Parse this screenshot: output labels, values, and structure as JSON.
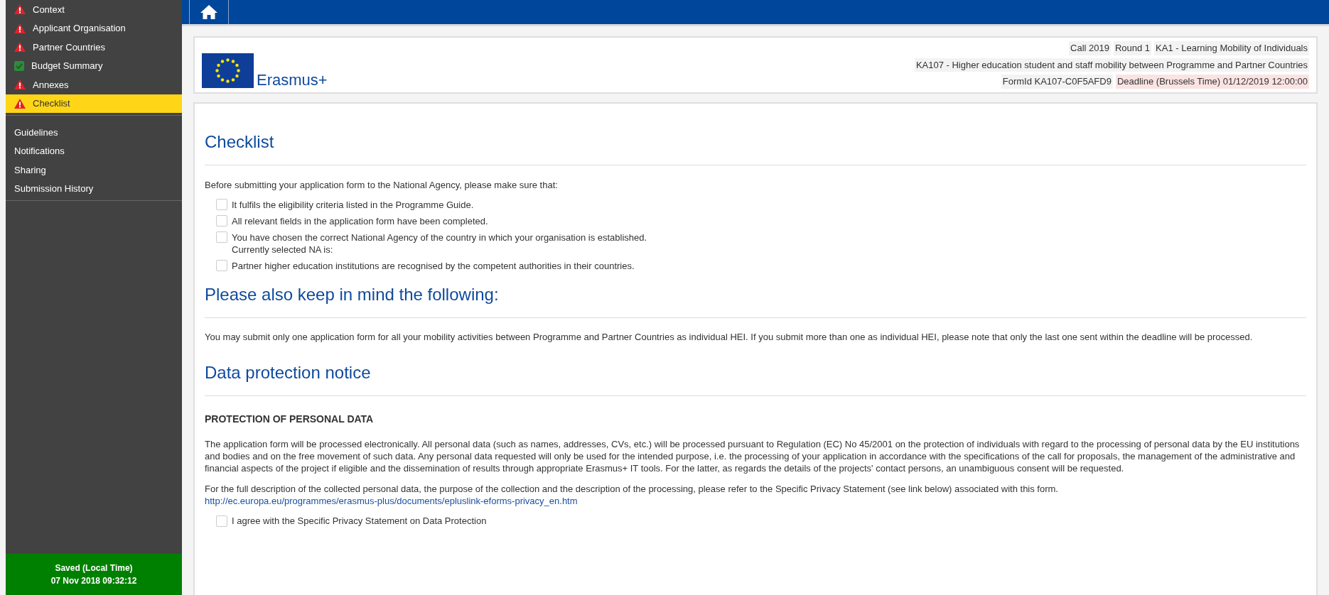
{
  "sidebar": {
    "sections": [
      {
        "kind": "status",
        "items": [
          {
            "label": "Context",
            "kind": "warning",
            "selected": false
          },
          {
            "label": "Applicant Organisation",
            "kind": "warning",
            "selected": false
          },
          {
            "label": "Partner Countries",
            "kind": "warning",
            "selected": false
          },
          {
            "label": "Budget Summary",
            "kind": "complete",
            "selected": false
          },
          {
            "label": "Annexes",
            "kind": "warning",
            "selected": false
          },
          {
            "label": "Checklist",
            "kind": "warning",
            "selected": true
          }
        ]
      },
      {
        "kind": "links",
        "items": [
          {
            "label": "Guidelines"
          },
          {
            "label": "Notifications"
          },
          {
            "label": "Sharing"
          },
          {
            "label": "Submission History"
          }
        ]
      }
    ],
    "saved": {
      "label": "Saved (Local Time)",
      "time": "07 Nov 2018 09:32:12"
    }
  },
  "header": {
    "logo_text": "Erasmus+",
    "info_rows": [
      [
        {
          "text": "Call 2019",
          "kind": "plain"
        },
        {
          "text": "Round 1",
          "kind": "plain"
        },
        {
          "text": "KA1 - Learning Mobility of Individuals",
          "kind": "plain"
        }
      ],
      [
        {
          "text": "KA107 - Higher education student and staff mobility between Programme and Partner Countries",
          "kind": "plain"
        }
      ],
      [
        {
          "text": "FormId KA107-C0F5AFD9",
          "kind": "plain"
        },
        {
          "text": "Deadline (Brussels Time) 01/12/2019 12:00:00",
          "kind": "deadline"
        }
      ]
    ]
  },
  "checklist": {
    "title": "Checklist",
    "intro": "Before submitting your application form to the National Agency, please make sure that:",
    "items": [
      {
        "text": "It fulfils the eligibility criteria listed in the Programme Guide.",
        "checked": false
      },
      {
        "text": "All relevant fields in the application form have been completed.",
        "checked": false
      },
      {
        "text": "You have chosen the correct National Agency of the country in which your organisation is established.",
        "note": "Currently selected NA is:",
        "checked": false
      },
      {
        "text": "Partner higher education institutions are recognised by the competent authorities in their countries.",
        "checked": false
      }
    ]
  },
  "reminder": {
    "title": "Please also keep in mind the following:",
    "text": "You may submit only one application form for all your mobility activities between Programme and Partner Countries as individual HEI. If you submit more than one as individual HEI, please note that only the last one sent within the deadline will be processed."
  },
  "data_protection": {
    "title": "Data protection notice",
    "subtitle": "PROTECTION OF PERSONAL DATA",
    "paragraph": "The application form will be processed electronically. All personal data (such as names, addresses, CVs, etc.) will be processed pursuant to Regulation (EC) No 45/2001 on the protection of individuals with regard to the processing of personal data by the EU institutions and bodies and on the free movement of such data. Any personal data requested will only be used for the intended purpose, i.e. the processing of your application in accordance with the specifications of the call for proposals, the management of the administrative and financial aspects of the project if eligible and the dissemination of results through appropriate Erasmus+ IT tools. For the latter, as regards the details of the projects' contact persons, an unambiguous consent will be requested.",
    "reference": "For the full description of the collected personal data, the purpose of the collection and the description of the processing, please refer to the Specific Privacy Statement (see link below) associated with this form.",
    "link": "http://ec.europa.eu/programmes/erasmus-plus/documents/epluslink-eforms-privacy_en.htm",
    "agree": {
      "text": "I agree with the Specific Privacy Statement on Data Protection",
      "checked": false
    }
  }
}
